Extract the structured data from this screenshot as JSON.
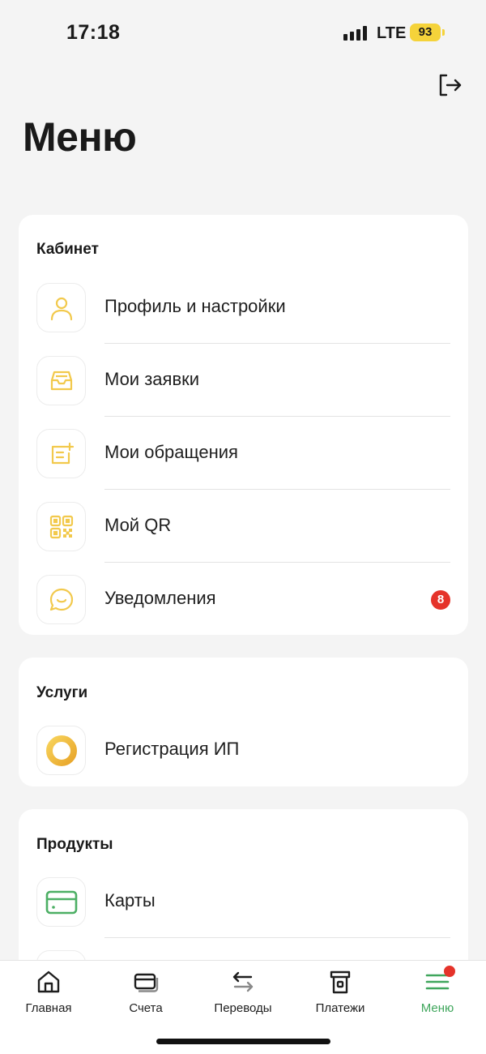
{
  "status": {
    "time": "17:18",
    "network": "LTE",
    "battery": "93"
  },
  "page": {
    "title": "Меню"
  },
  "cabinet": {
    "title": "Кабинет",
    "items": [
      {
        "label": "Профиль и настройки",
        "icon": "user-icon"
      },
      {
        "label": "Мои заявки",
        "icon": "inbox-tray-icon"
      },
      {
        "label": "Мои обращения",
        "icon": "note-add-icon"
      },
      {
        "label": "Мой QR",
        "icon": "qr-code-icon"
      },
      {
        "label": "Уведомления",
        "icon": "chat-bubble-icon",
        "badge": "8"
      }
    ]
  },
  "services": {
    "title": "Услуги",
    "items": [
      {
        "label": "Регистрация ИП",
        "icon": "ring-icon"
      }
    ]
  },
  "products": {
    "title": "Продукты",
    "items": [
      {
        "label": "Карты",
        "icon": "card-icon"
      }
    ]
  },
  "tabbar": {
    "items": [
      {
        "label": "Главная",
        "icon": "home-icon"
      },
      {
        "label": "Счета",
        "icon": "accounts-icon"
      },
      {
        "label": "Переводы",
        "icon": "transfer-arrows-icon"
      },
      {
        "label": "Платежи",
        "icon": "payment-terminal-icon"
      },
      {
        "label": "Меню",
        "icon": "menu-lines-icon",
        "active": true
      }
    ]
  },
  "colors": {
    "accent_yellow": "#f2c94c",
    "accent_green": "#3fa65c",
    "badge_red": "#e5332a",
    "background": "#f4f4f4"
  }
}
